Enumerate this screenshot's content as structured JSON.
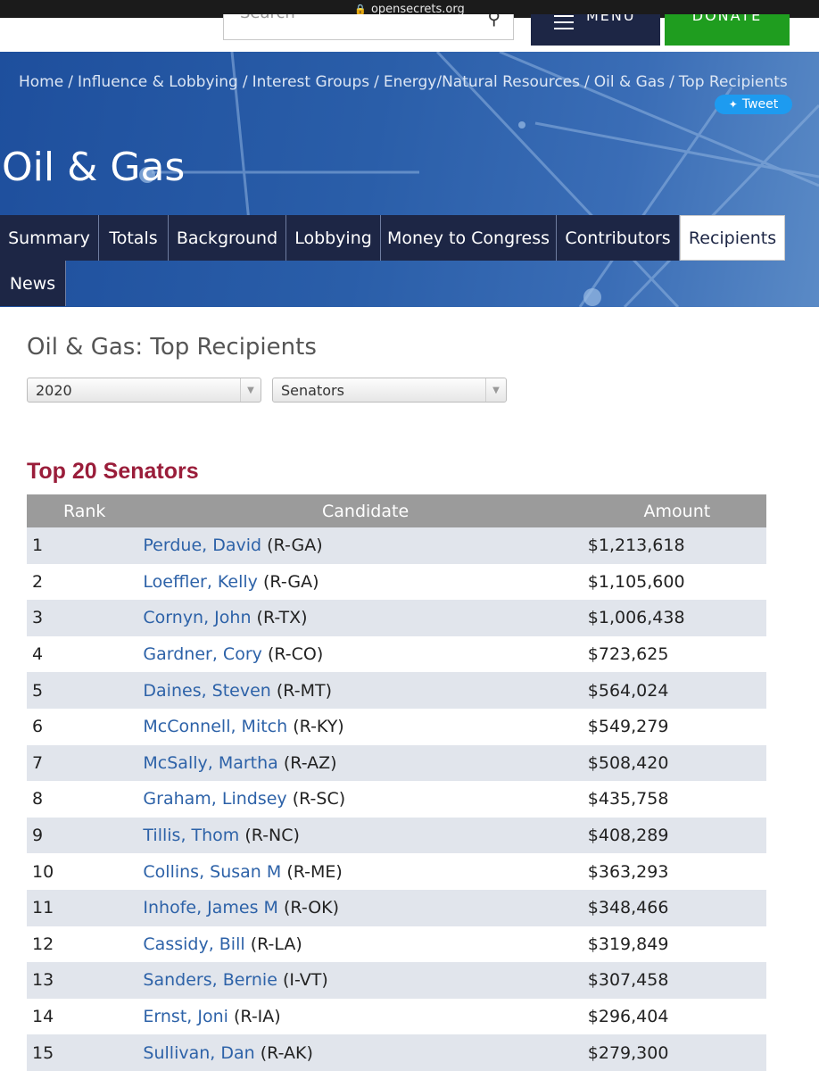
{
  "browser": {
    "domain": "opensecrets.org"
  },
  "header": {
    "search_placeholder": "Search",
    "menu_label": "MENU",
    "donate_label": "DONATE"
  },
  "breadcrumb": [
    "Home",
    "Influence & Lobbying",
    "Interest Groups",
    "Energy/Natural Resources",
    "Oil & Gas",
    "Top Recipients"
  ],
  "tweet_label": "Tweet",
  "hero_title": "Oil & Gas",
  "tabs": [
    "Summary",
    "Totals",
    "Background",
    "Lobbying",
    "Money to Congress",
    "Contributors",
    "Recipients",
    "News"
  ],
  "active_tab": "Recipients",
  "page_heading": "Oil & Gas: Top Recipients",
  "filters": {
    "cycle": "2020",
    "chamber": "Senators"
  },
  "section_title": "Top 20 Senators",
  "table": {
    "headers": [
      "Rank",
      "Candidate",
      "Amount"
    ],
    "rows": [
      {
        "rank": "1",
        "name": "Perdue, David",
        "party": "(R-GA)",
        "amount": "$1,213,618"
      },
      {
        "rank": "2",
        "name": "Loeffler, Kelly",
        "party": "(R-GA)",
        "amount": "$1,105,600"
      },
      {
        "rank": "3",
        "name": "Cornyn, John",
        "party": "(R-TX)",
        "amount": "$1,006,438"
      },
      {
        "rank": "4",
        "name": "Gardner, Cory",
        "party": "(R-CO)",
        "amount": "$723,625"
      },
      {
        "rank": "5",
        "name": "Daines, Steven",
        "party": "(R-MT)",
        "amount": "$564,024"
      },
      {
        "rank": "6",
        "name": "McConnell, Mitch",
        "party": "(R-KY)",
        "amount": "$549,279"
      },
      {
        "rank": "7",
        "name": "McSally, Martha",
        "party": "(R-AZ)",
        "amount": "$508,420"
      },
      {
        "rank": "8",
        "name": "Graham, Lindsey",
        "party": "(R-SC)",
        "amount": "$435,758"
      },
      {
        "rank": "9",
        "name": "Tillis, Thom",
        "party": "(R-NC)",
        "amount": "$408,289"
      },
      {
        "rank": "10",
        "name": "Collins, Susan M",
        "party": "(R-ME)",
        "amount": "$363,293"
      },
      {
        "rank": "11",
        "name": "Inhofe, James M",
        "party": "(R-OK)",
        "amount": "$348,466"
      },
      {
        "rank": "12",
        "name": "Cassidy, Bill",
        "party": "(R-LA)",
        "amount": "$319,849"
      },
      {
        "rank": "13",
        "name": "Sanders, Bernie",
        "party": "(I-VT)",
        "amount": "$307,458"
      },
      {
        "rank": "14",
        "name": "Ernst, Joni",
        "party": "(R-IA)",
        "amount": "$296,404"
      },
      {
        "rank": "15",
        "name": "Sullivan, Dan",
        "party": "(R-AK)",
        "amount": "$279,300"
      }
    ]
  },
  "colors": {
    "nav": "#1d2645",
    "donate": "#1f9d1f",
    "section_title": "#9a1d3a",
    "link": "#2d62a8",
    "row_stripe": "#e1e5ec",
    "table_header": "#9b9b9b"
  }
}
